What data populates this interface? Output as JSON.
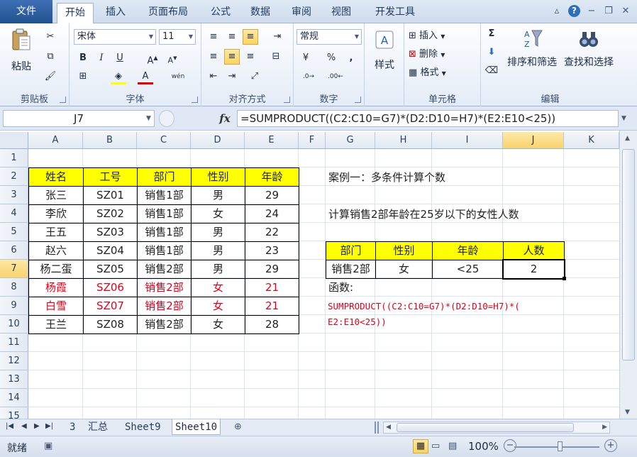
{
  "tabs": [
    "文件",
    "开始",
    "插入",
    "页面布局",
    "公式",
    "数据",
    "审阅",
    "视图",
    "开发工具"
  ],
  "active_tab": "开始",
  "ribbon": {
    "clipboard": {
      "paste": "粘贴",
      "label": "剪贴板"
    },
    "font": {
      "name": "宋体",
      "size": "11",
      "label": "字体",
      "bold": "B",
      "italic": "I",
      "underline": "U",
      "phonetic": "wén"
    },
    "alignment": {
      "label": "对齐方式"
    },
    "number": {
      "format": "常规",
      "label": "数字",
      "percent": "%"
    },
    "styles": {
      "label": "样式"
    },
    "cells": {
      "insert": "插入",
      "delete": "删除",
      "format": "格式",
      "label": "单元格"
    },
    "editing": {
      "sort_filter": "排序和筛选",
      "find_select": "查找和选择",
      "label": "编辑"
    }
  },
  "formula_bar": {
    "name_box": "J7",
    "fx": "fx",
    "formula": "=SUMPRODUCT((C2:C10=G7)*(D2:D10=H7)*(E2:E10<25))"
  },
  "columns": [
    "A",
    "B",
    "C",
    "D",
    "E",
    "F",
    "G",
    "H",
    "I",
    "J",
    "K"
  ],
  "selected_column": "J",
  "rows": [
    "1",
    "2",
    "3",
    "4",
    "5",
    "6",
    "7",
    "8",
    "9",
    "10",
    "11",
    "12",
    "13",
    "14",
    "15"
  ],
  "selected_row": "7",
  "table": {
    "headers": [
      "姓名",
      "工号",
      "部门",
      "性别",
      "年龄"
    ],
    "rows": [
      [
        "张三",
        "SZ01",
        "销售1部",
        "男",
        "29"
      ],
      [
        "李欣",
        "SZ02",
        "销售1部",
        "女",
        "24"
      ],
      [
        "王五",
        "SZ03",
        "销售1部",
        "男",
        "22"
      ],
      [
        "赵六",
        "SZ04",
        "销售1部",
        "男",
        "23"
      ],
      [
        "杨二蛋",
        "SZ05",
        "销售2部",
        "男",
        "29"
      ],
      [
        "杨霞",
        "SZ06",
        "销售2部",
        "女",
        "21"
      ],
      [
        "白雪",
        "SZ07",
        "销售2部",
        "女",
        "21"
      ],
      [
        "王兰",
        "SZ08",
        "销售2部",
        "女",
        "28"
      ]
    ]
  },
  "case": {
    "title": "案例一：多条件计算个数",
    "description": "计算销售2部年龄在25岁以下的女性人数",
    "criteria_headers": [
      "部门",
      "性别",
      "年龄",
      "人数"
    ],
    "criteria_values": [
      "销售2部",
      "女",
      "<25",
      "2"
    ],
    "func_label": "函数:",
    "func_line1": "SUMPRODUCT((C2:C10=G7)*(D2:D10=H7)*(",
    "func_line2": "E2:E10<25))"
  },
  "sheets": [
    "3",
    "汇总",
    "Sheet9",
    "Sheet10"
  ],
  "active_sheet": "Sheet10",
  "status": {
    "ready": "就绪",
    "zoom": "100%"
  },
  "colors": {
    "accent": "#2b5797",
    "highlight": "#ffff00",
    "red_text": "#e0001b"
  }
}
